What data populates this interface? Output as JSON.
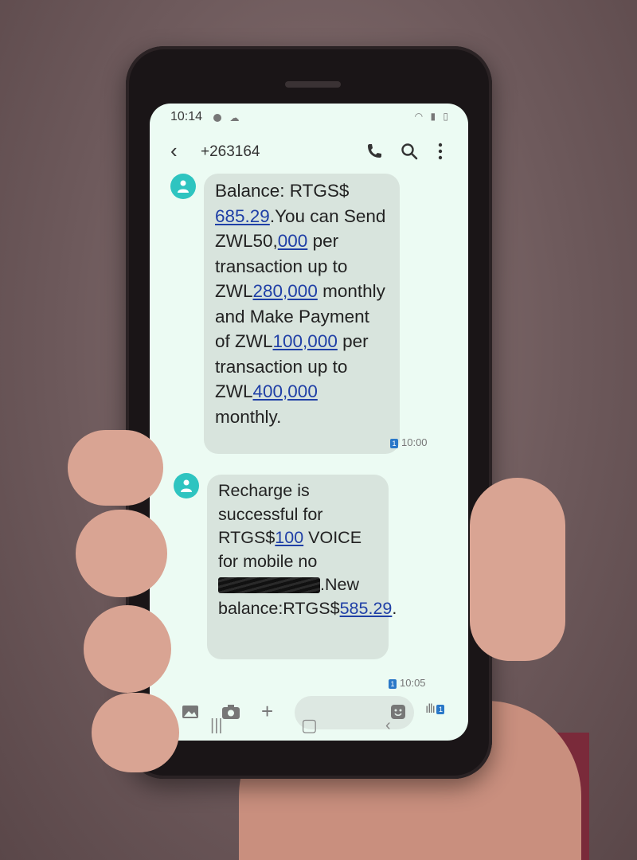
{
  "status": {
    "time": "10:14"
  },
  "header": {
    "contact": "+263164"
  },
  "messages": [
    {
      "parts": [
        "Balance: RTGS$ ",
        "685.29",
        ".You can Send ZWL50,",
        "000",
        " per transaction up to ZWL",
        "280,000",
        " monthly and Make Payment of ZWL",
        "100,000",
        " per transaction up to ZWL",
        "400,000",
        " monthly."
      ],
      "time": "10:00",
      "sim": "1"
    },
    {
      "parts": [
        "Recharge is successful for RTGS$",
        "100",
        " VOICE for mobile no ",
        ".New balance:RTGS$",
        "58",
        "5.29",
        "."
      ],
      "time": "10:05",
      "sim": "1"
    }
  ],
  "composer": {
    "voice_sim": "1"
  },
  "colors": {
    "screen": "#ecfbf3",
    "bubble": "#d8e4dd",
    "avatar": "#2ec4c0",
    "link": "#1f3fa6"
  }
}
